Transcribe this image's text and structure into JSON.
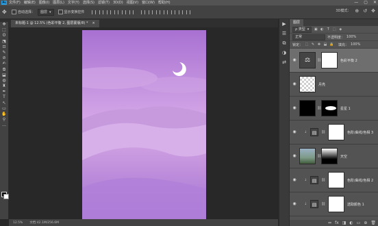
{
  "menu": {
    "logo": "Ps",
    "items": [
      "文件(F)",
      "编辑(E)",
      "图像(I)",
      "图层(L)",
      "文字(Y)",
      "选择(S)",
      "滤镜(T)",
      "3D(D)",
      "视图(V)",
      "窗口(W)",
      "帮助(H)"
    ],
    "window_controls": [
      "—",
      "▢",
      "✕"
    ]
  },
  "options": {
    "auto_select_label": "自动选择：",
    "auto_select_value": "图层",
    "show_transform_label": "显示变换控件",
    "right_icons": [
      "3D模式：",
      "⊕",
      "↺",
      "✥"
    ]
  },
  "document": {
    "tab_title": "未标题-1 @ 12.5% (色彩平衡 2, 图层蒙版/8) *",
    "tab_close": "×"
  },
  "toolbar": {
    "tools": [
      "✥",
      "⬚",
      "ʘ",
      "⬔",
      "⊡",
      "✎",
      "⊘",
      "✍",
      "⧉",
      "⬓",
      "◍",
      "♜",
      "✒",
      "T",
      "↖",
      "▭",
      "✋",
      "⚲",
      "…"
    ]
  },
  "status": {
    "zoom": "12.5%",
    "doc_info": "文档:42.1M/256.6M"
  },
  "minidock": {
    "icons": [
      "▶",
      "☰",
      "⧉",
      "◑",
      "⇄"
    ]
  },
  "panel": {
    "tab_label": "图层",
    "filter_label": "ρ 类型",
    "filter_icons": [
      "▣",
      "◐",
      "T",
      "⬚",
      "◈"
    ],
    "blend_mode": "正常",
    "opacity_label": "不透明度：",
    "opacity_value": "100%",
    "lock_label": "锁定：",
    "lock_icons": [
      "⬚",
      "✎",
      "✥",
      "⬓",
      "🔒"
    ],
    "fill_label": "填充：",
    "fill_value": "100%",
    "footer_icons": [
      "⇔",
      "fx",
      "◨",
      "◐",
      "▭",
      "⊕",
      "🗑"
    ],
    "layers": [
      {
        "name": "色彩平衡 2",
        "thumb": "adjustment-balance",
        "mask": "white",
        "selected": true
      },
      {
        "name": "月亮",
        "thumb": "moon",
        "mask": "",
        "selected": false
      },
      {
        "name": "星星 1",
        "thumb": "stars-black",
        "mask": "smudge",
        "selected": false
      },
      {
        "name": "色阶/曲线/色相 3",
        "thumb": "adjustment-levels",
        "mask": "white",
        "selected": false,
        "clipped": true
      },
      {
        "name": "天空",
        "thumb": "sky-photo",
        "mask": "gradient",
        "selected": false
      },
      {
        "name": "色阶/曲线/色相 2",
        "thumb": "adjustment-levels",
        "mask": "white",
        "selected": false,
        "clipped": true
      },
      {
        "name": "选取颜色 1",
        "thumb": "adjustment-selective",
        "mask": "white",
        "selected": false,
        "clipped": true
      }
    ]
  }
}
